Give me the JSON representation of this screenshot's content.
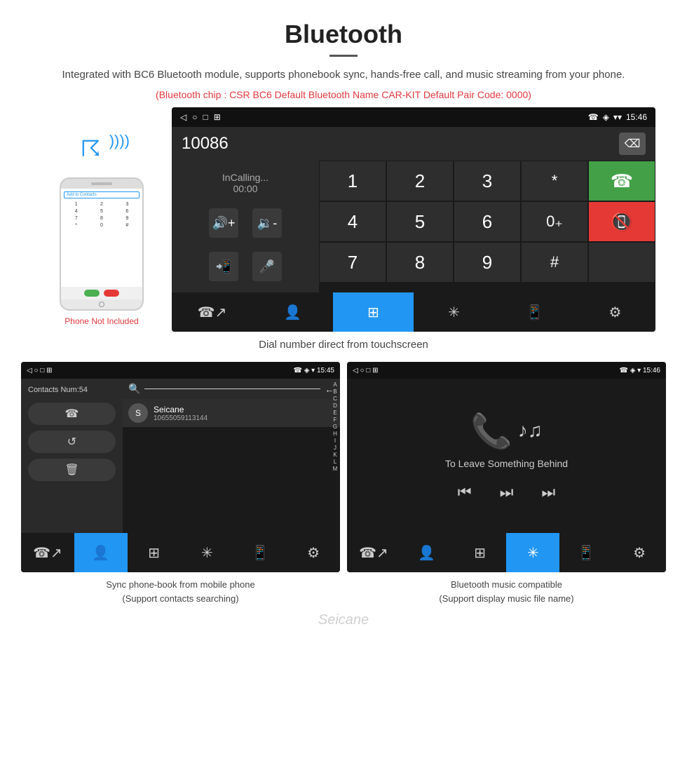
{
  "header": {
    "title": "Bluetooth",
    "description": "Integrated with BC6 Bluetooth module, supports phonebook sync, hands-free call, and music streaming from your phone.",
    "specs": "(Bluetooth chip : CSR BC6    Default Bluetooth Name CAR-KIT    Default Pair Code: 0000)"
  },
  "dial_screen": {
    "status_bar": {
      "left": [
        "◁",
        "○",
        "□",
        "⊞"
      ],
      "right": [
        "☎",
        "◈",
        "▾",
        "15:46"
      ]
    },
    "number": "10086",
    "calling_label": "InCalling...",
    "timer": "00:00",
    "dialpad": [
      "1",
      "2",
      "3",
      "*",
      "",
      "4",
      "5",
      "6",
      "0₊",
      "",
      "7",
      "8",
      "9",
      "#",
      ""
    ],
    "caption": "Dial number direct from touchscreen"
  },
  "contacts_screen": {
    "status_bar_time": "15:45",
    "contacts_count": "Contacts Num:54",
    "search_placeholder": "Search",
    "contact_name": "Seicane",
    "contact_number": "10655059113144",
    "alpha_list": [
      "A",
      "B",
      "C",
      "D",
      "E",
      "F",
      "G",
      "H",
      "I",
      "J",
      "K",
      "L",
      "M"
    ],
    "caption_line1": "Sync phone-book from mobile phone",
    "caption_line2": "(Support contacts searching)"
  },
  "music_screen": {
    "status_bar_time": "15:46",
    "song_title": "To Leave Something Behind",
    "caption_line1": "Bluetooth music compatible",
    "caption_line2": "(Support display music file name)"
  },
  "phone_mockup": {
    "not_included": "Phone Not Included",
    "add_contacts": "Add to Contacts",
    "dialpad_keys": [
      "1",
      "2",
      "3",
      "4",
      "5",
      "6",
      "7",
      "8",
      "9",
      "*",
      "0",
      "#"
    ]
  },
  "nav_items": {
    "call": "📞",
    "contact": "👤",
    "dialpad": "⊞",
    "bluetooth": "✳",
    "phone_out": "📱",
    "settings": "⚙"
  },
  "watermark": "Seicane"
}
